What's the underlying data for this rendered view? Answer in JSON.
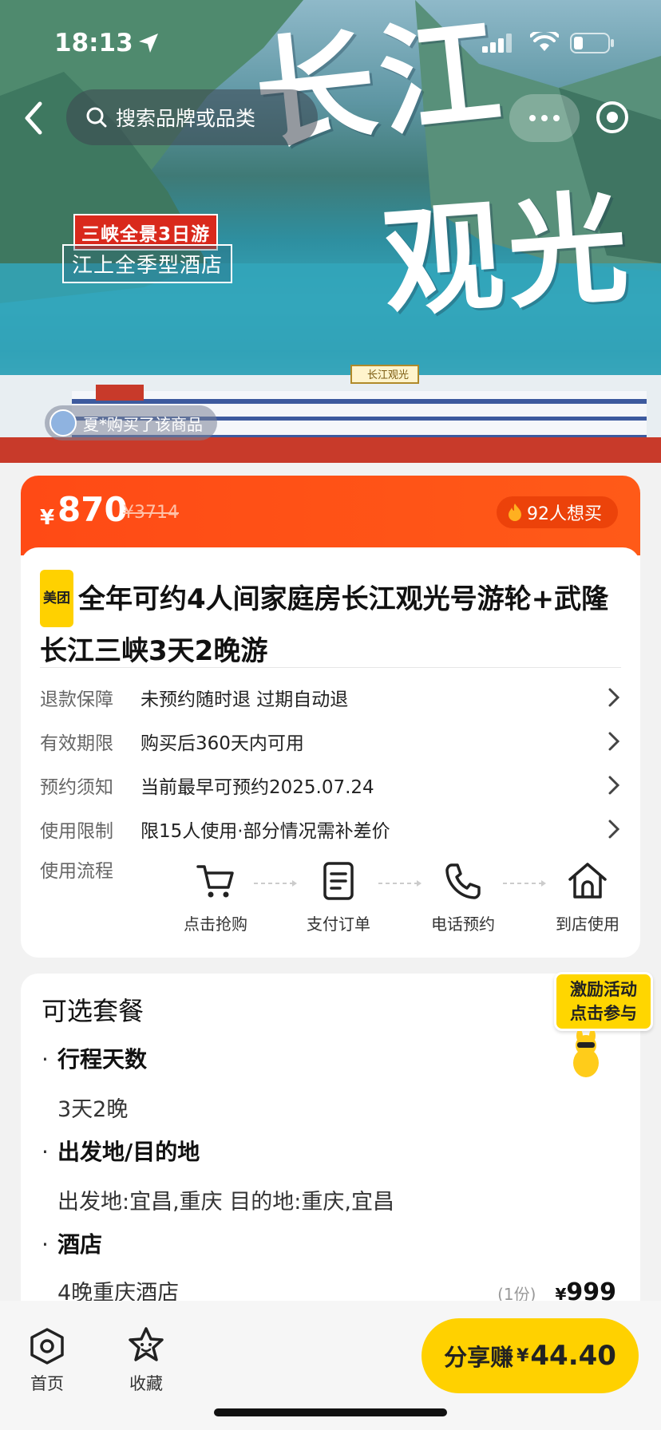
{
  "status_bar": {
    "time": "18:13"
  },
  "header": {
    "search_placeholder": "搜索品牌或品类"
  },
  "hero": {
    "title_line1": "长江",
    "title_line2": "观光",
    "tag1": "三峡全景3日游",
    "tag2": "江上全季型酒店",
    "ship_sign": "长江观光",
    "buyer_notice": "夏*购买了该商品"
  },
  "price": {
    "currency": "¥",
    "current": "870",
    "original": "¥3714",
    "want_count": "92人想买"
  },
  "product": {
    "brand_badge": "美团",
    "title": "全年可约4人间家庭房长江观光号游轮+武隆长江三峡3天2晚游"
  },
  "info_rows": [
    {
      "label": "退款保障",
      "value": "未预约随时退 过期自动退"
    },
    {
      "label": "有效期限",
      "value": "购买后360天内可用"
    },
    {
      "label": "预约须知",
      "value": "当前最早可预约2025.07.24"
    },
    {
      "label": "使用限制",
      "value": "限15人使用·部分情况需补差价"
    }
  ],
  "flow": {
    "label": "使用流程",
    "steps": [
      {
        "label": "点击抢购",
        "icon": "cart-icon"
      },
      {
        "label": "支付订单",
        "icon": "document-icon"
      },
      {
        "label": "电话预约",
        "icon": "phone-icon"
      },
      {
        "label": "到店使用",
        "icon": "store-icon"
      }
    ]
  },
  "packages": {
    "title": "可选套餐",
    "sections": [
      {
        "title": "行程天数",
        "value": "3天2晚"
      },
      {
        "title": "出发地/目的地",
        "value": "出发地:宜昌,重庆 目的地:重庆,宜昌"
      },
      {
        "title": "酒店"
      }
    ],
    "hotel": {
      "name": "4晚重庆酒店",
      "qty": "(1份)",
      "currency": "¥",
      "price": "999"
    }
  },
  "promo": {
    "line1": "激励活动",
    "line2": "点击参与"
  },
  "bottom_bar": {
    "home_label": "首页",
    "favorite_label": "收藏",
    "share_prefix": "分享赚",
    "share_currency": "¥",
    "share_amount": "44.40"
  },
  "colors": {
    "accent_orange": "#ff4a15",
    "accent_yellow": "#ffd100"
  }
}
